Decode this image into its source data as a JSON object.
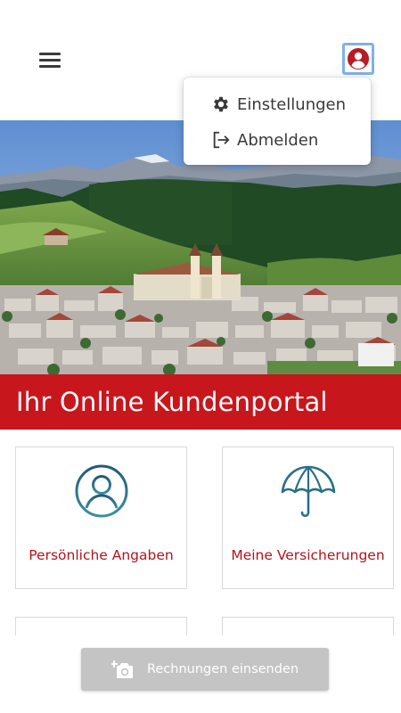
{
  "header": {
    "menu_icon": "hamburger-icon",
    "user_icon": "user-circle-icon"
  },
  "dropdown": {
    "items": [
      {
        "label": "Einstellungen",
        "icon": "gear-icon"
      },
      {
        "label": "Abmelden",
        "icon": "logout-icon"
      }
    ]
  },
  "banner": {
    "title": "Ihr Online Kundenportal"
  },
  "cards": [
    {
      "label": "Persönliche Angaben",
      "icon": "person-icon"
    },
    {
      "label": "Meine Versicherungen",
      "icon": "umbrella-icon"
    }
  ],
  "action_button": {
    "label": "Rechnungen einsenden",
    "icon": "add-photo-icon"
  },
  "colors": {
    "brand_red": "#c8161d",
    "card_label": "#b0151c",
    "icon_teal": "#2a6f88",
    "button_disabled": "#c4c4c4"
  }
}
